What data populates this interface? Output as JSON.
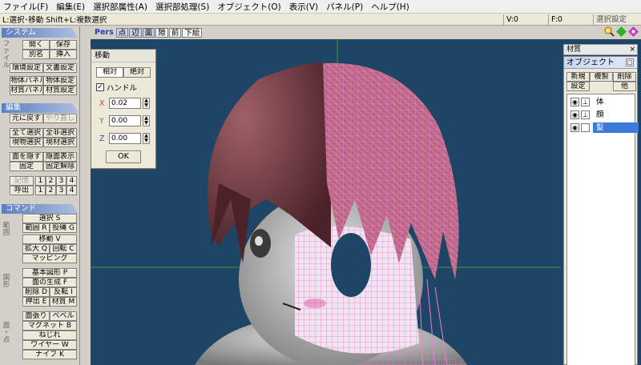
{
  "menu": [
    "ファイル(F)",
    "編集(E)",
    "選択部属性(A)",
    "選択部処理(S)",
    "オブジェクト(O)",
    "表示(V)",
    "パネル(P)",
    "ヘルプ(H)"
  ],
  "status": {
    "hint": "L:選択･移動  Shift+L:複数選択",
    "v": "V:0",
    "f": "F:0",
    "mode": "選択設定"
  },
  "left": {
    "system": {
      "header": "システム",
      "vlabel": "ファイル",
      "open": "開く",
      "save": "保存",
      "saveas": "別名",
      "insert": "挿入",
      "env": "環境設定",
      "doc": "文書設定",
      "objpanel": "物体パネル",
      "objset": "物体設定",
      "matpanel": "材質パネル",
      "matset": "材質設定"
    },
    "edit": {
      "header": "編集",
      "undo": "元に戻す",
      "redo": "やり直し",
      "selall": "全て選択",
      "deselall": "全非選択",
      "selobj": "現物選択",
      "selmat": "現材選択",
      "hide": "面を隠す",
      "showall": "隠面表示",
      "fix": "固定",
      "unfix": "固定解除",
      "mem": "記憶",
      "recall": "呼出",
      "n1": "1",
      "n2": "2",
      "n3": "3",
      "n4": "4"
    },
    "command": {
      "header": "コマンド",
      "vl1": "範 囲",
      "vl2": "図 形",
      "vl3": "面 ・ 点",
      "select": "選択 S",
      "range": "範囲 R",
      "lasso": "投縄 G",
      "move": "移動 V",
      "scale": "拡大 Q",
      "rotate": "回転 C",
      "mapping": "マッピング",
      "basic": "基本図形 P",
      "facegen": "面の生成 F",
      "delete": "削除 D",
      "invert": "反転 I",
      "extrude": "押出 E",
      "material": "材質 M",
      "facestretch": "面張り",
      "bevel": "ベベル",
      "magnet": "マグネット B",
      "twist": "ねじれ",
      "wire": "ワイヤー W",
      "knife": "ナイフ K"
    }
  },
  "viewbar": {
    "pers": "Pers",
    "point": "点",
    "edge": "辺",
    "face": "面",
    "thru": "隙",
    "front": "前",
    "lower": "下絵"
  },
  "movedlg": {
    "title": "移動",
    "relative": "相対",
    "absolute": "絶対",
    "handle_label": "ハンドル",
    "handle_checked": true,
    "x_label": "X",
    "y_label": "Y",
    "z_label": "Z",
    "x": "0.02",
    "y": "0.00",
    "z": "0.00",
    "ok": "OK"
  },
  "right": {
    "mat_title": "材質",
    "obj_title": "オブジェクト",
    "new": "新規",
    "copy": "複製",
    "delete": "削除",
    "settings": "設定",
    "other": "他",
    "objects": [
      {
        "name": "体",
        "selected": false
      },
      {
        "name": "顔",
        "selected": false
      },
      {
        "name": "髪",
        "selected": true
      }
    ]
  },
  "colors": {
    "viewport_bg": "#1f4566",
    "mesh_pink": "#f07ad0",
    "hair": "#8a4a50",
    "select_blue": "#3a7ad8"
  }
}
